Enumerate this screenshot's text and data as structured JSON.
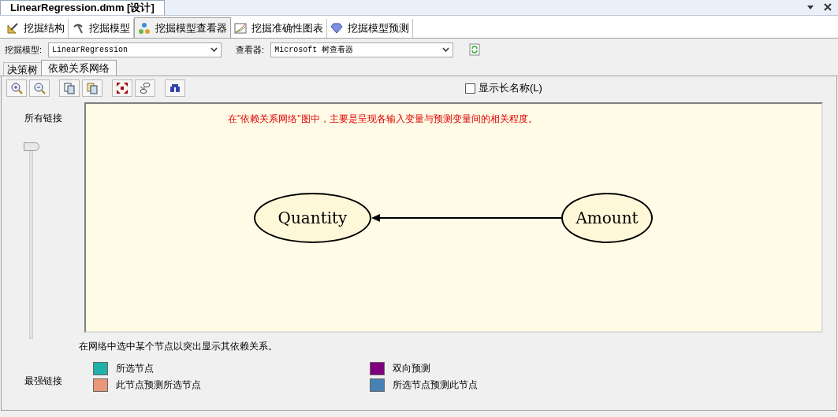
{
  "document_tab": {
    "title": "LinearRegression.dmm [设计]"
  },
  "design_tabs": [
    {
      "label": "挖掘结构",
      "selected": false,
      "kind": "structure"
    },
    {
      "label": "挖掘模型",
      "selected": false,
      "kind": "model"
    },
    {
      "label": "挖掘模型查看器",
      "selected": true,
      "kind": "viewer"
    },
    {
      "label": "挖掘准确性图表",
      "selected": false,
      "kind": "chart"
    },
    {
      "label": "挖掘模型预测",
      "selected": false,
      "kind": "predict"
    }
  ],
  "model_select": {
    "label": "挖掘模型:",
    "value": "LinearRegression"
  },
  "viewer_select": {
    "label": "查看器:",
    "value": "Microsoft 树查看器"
  },
  "sub_tabs": [
    {
      "label": "决策树",
      "selected": false
    },
    {
      "label": "依赖关系网络",
      "selected": true
    }
  ],
  "show_long_names": {
    "label": "显示长名称(L)",
    "checked": false
  },
  "slider": {
    "top_label": "所有链接",
    "bottom_label": "最强链接",
    "level": 0
  },
  "canvas": {
    "hint": "在\"依赖关系网络\"图中，主要是呈现各输入变量与预测变量间的相关程度。",
    "nodes": [
      {
        "label": "Quantity"
      },
      {
        "label": "Amount"
      }
    ]
  },
  "instruction": "在网络中选中某个节点以突出显示其依赖关系。",
  "legend": [
    {
      "label": "所选节点",
      "color": "#20b2aa"
    },
    {
      "label": "双向预测",
      "color": "#800080"
    },
    {
      "label": "此节点预测所选节点",
      "color": "#e9967a"
    },
    {
      "label": "所选节点预测此节点",
      "color": "#4682b4"
    }
  ]
}
